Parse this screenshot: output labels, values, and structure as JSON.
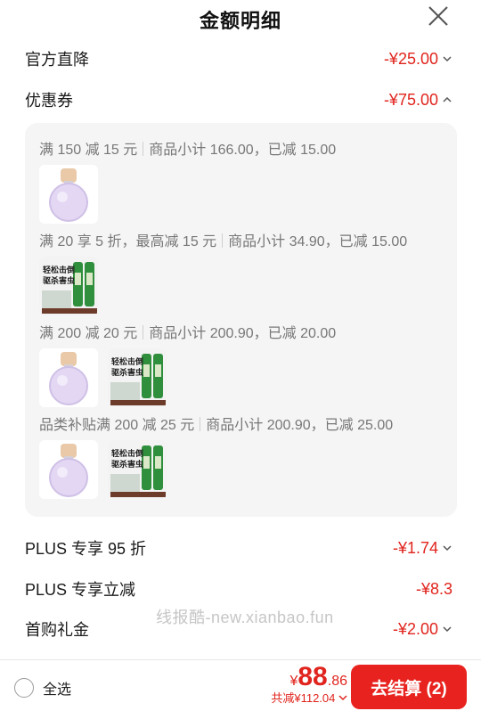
{
  "header": {
    "title": "金额明细"
  },
  "rows": {
    "official_discount": {
      "label": "官方直降",
      "amount": "-¥25.00"
    },
    "coupon": {
      "label": "优惠券",
      "amount": "-¥75.00"
    },
    "plus_95": {
      "label": "PLUS 专享 95 折",
      "amount": "-¥1.74"
    },
    "plus_instant": {
      "label": "PLUS 专享立减",
      "amount": "-¥8.3"
    },
    "first_gift": {
      "label": "首购礼金",
      "amount": "-¥2.00"
    }
  },
  "coupon_rules": [
    {
      "condition": "满 150 减 15 元",
      "detail": "商品小计 166.00，已减 15.00"
    },
    {
      "condition": "满 20 享 5 折，最高减 15 元",
      "detail": "商品小计 34.90，已减 15.00"
    },
    {
      "condition": "满 200 减 20 元",
      "detail": "商品小计 200.90，已减 20.00"
    },
    {
      "condition": "品类补贴满 200 减 25 元",
      "detail": "商品小计 200.90，已减 25.00"
    }
  ],
  "insecticide_text": {
    "line1": "轻松击倒",
    "line2": "驱杀害虫"
  },
  "watermark": "线报酷-new.xianbao.fun",
  "bottom": {
    "select_all": "全选",
    "currency": "¥",
    "price_int": "88",
    "price_dec": ".86",
    "saved": "共减¥112.04",
    "checkout": "去结算 (2)"
  },
  "colors": {
    "accent": "#e0241d",
    "button": "#e8231f"
  }
}
